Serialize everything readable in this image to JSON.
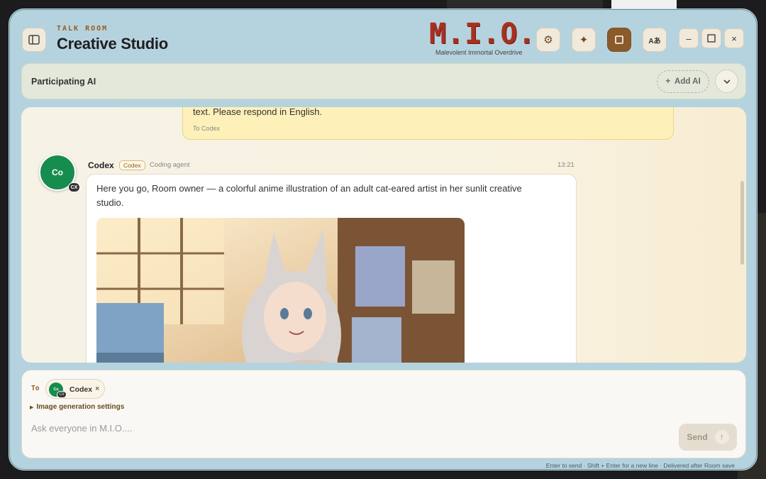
{
  "header": {
    "kicker": "TALK ROOM",
    "title": "Creative Studio",
    "logo": "M.I.O.",
    "logo_subtitle": "Malevolent Immortal Overdrive",
    "lang_label": "Aあ"
  },
  "participants": {
    "label": "Participating AI",
    "add_label": "Add AI"
  },
  "messages": {
    "outgoing": {
      "text": "text. Please respond in English.",
      "recipient": "To Codex"
    },
    "reply": {
      "avatar_initials": "Co",
      "badge": "CX",
      "sender": "Codex",
      "tag": "Codex",
      "role": "Coding agent",
      "time": "13:21",
      "text": "Here you go, Room owner — a colorful anime illustration of an adult cat-eared artist in her sunlit creative studio."
    }
  },
  "composer": {
    "to_label": "To",
    "recipient_chip": {
      "initials": "Co",
      "badge": "CX",
      "name": "Codex",
      "remove": "×"
    },
    "image_settings_label": "Image generation settings",
    "placeholder": "Ask everyone in M.I.O....",
    "value": "",
    "send_label": "Send",
    "hint": "Enter to send · Shift + Enter for a new line · Delivered after Room save"
  },
  "colors": {
    "window_bg": "#b5d3df",
    "accent_brown": "#8b5a2b",
    "logo_red": "#a8301f",
    "avatar_green": "#178c4f",
    "outgoing_bubble": "#fdf0b9"
  },
  "icons": {
    "sidebar_toggle": "sidebar-icon",
    "settings": "gear-icon",
    "sparkle": "sparkle-icon",
    "active_view": "square-icon",
    "language": "translate-icon",
    "minimize": "minimize-icon",
    "maximize": "maximize-icon",
    "close": "close-icon",
    "collapse": "chevron-down-icon",
    "add": "plus-icon",
    "send": "arrow-up-icon"
  }
}
